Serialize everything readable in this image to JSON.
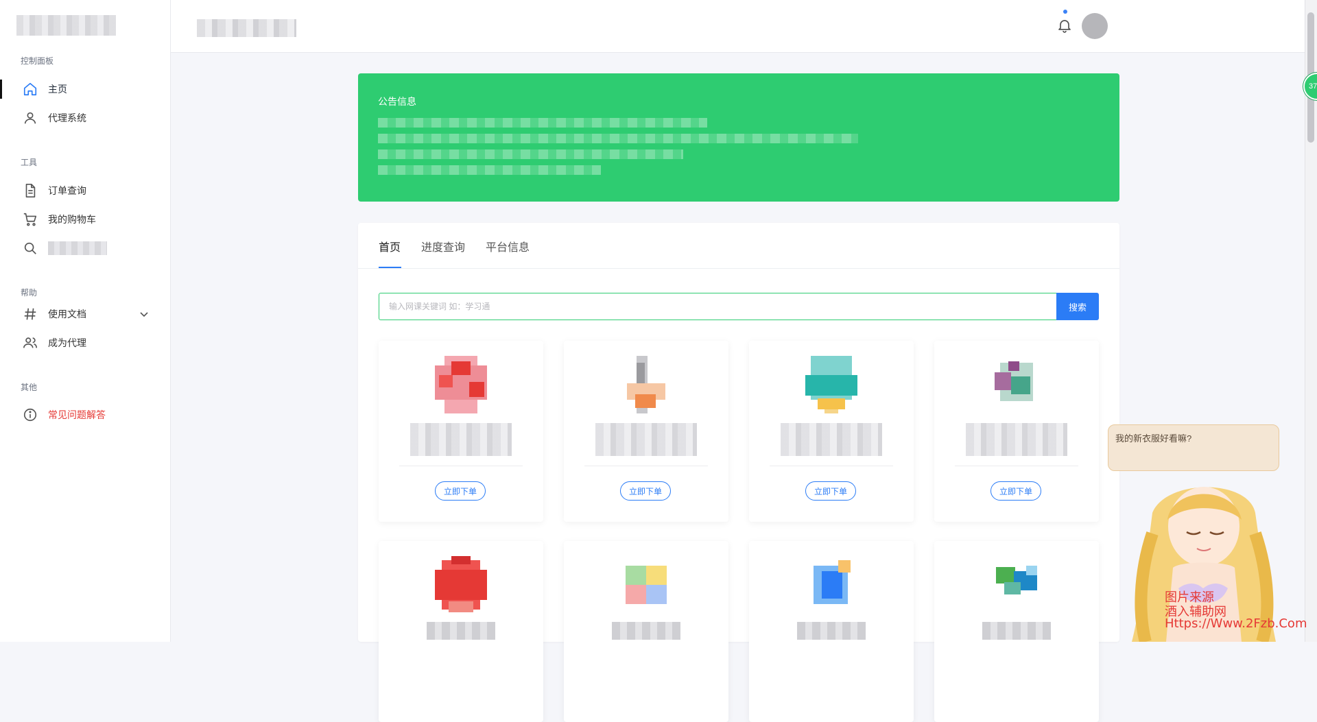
{
  "sidebar": {
    "sections": [
      {
        "title": "控制面板"
      },
      {
        "title": "工具"
      },
      {
        "title": "帮助"
      },
      {
        "title": "其他"
      }
    ],
    "items": [
      {
        "label": "主页",
        "icon": "home-icon"
      },
      {
        "label": "代理系统",
        "icon": "user-icon"
      },
      {
        "label": "订单查询",
        "icon": "document-icon"
      },
      {
        "label": "我的购物车",
        "icon": "cart-icon"
      },
      {
        "label": "",
        "icon": "search-icon"
      },
      {
        "label": "使用文档",
        "icon": "hash-icon"
      },
      {
        "label": "成为代理",
        "icon": "users-icon"
      },
      {
        "label": "常见问题解答",
        "icon": "info-icon"
      }
    ]
  },
  "topbar": {
    "badge_text": "37"
  },
  "notice": {
    "title": "公告信息"
  },
  "tabs": [
    {
      "label": "首页"
    },
    {
      "label": "进度查询"
    },
    {
      "label": "平台信息"
    }
  ],
  "search": {
    "placeholder": "输入网课关键词 如：学习通",
    "button_label": "搜索"
  },
  "products": {
    "order_label": "立即下单"
  },
  "mascot": {
    "bubble_text": "我的新衣服好看嘛?",
    "watermark": [
      "图片来源",
      "酒入辅助网",
      "Https://Www.2Fzb.Com"
    ]
  },
  "colors": {
    "accent": "#2b7cf6",
    "notice_green": "#2ecc71",
    "danger": "#e53935"
  }
}
